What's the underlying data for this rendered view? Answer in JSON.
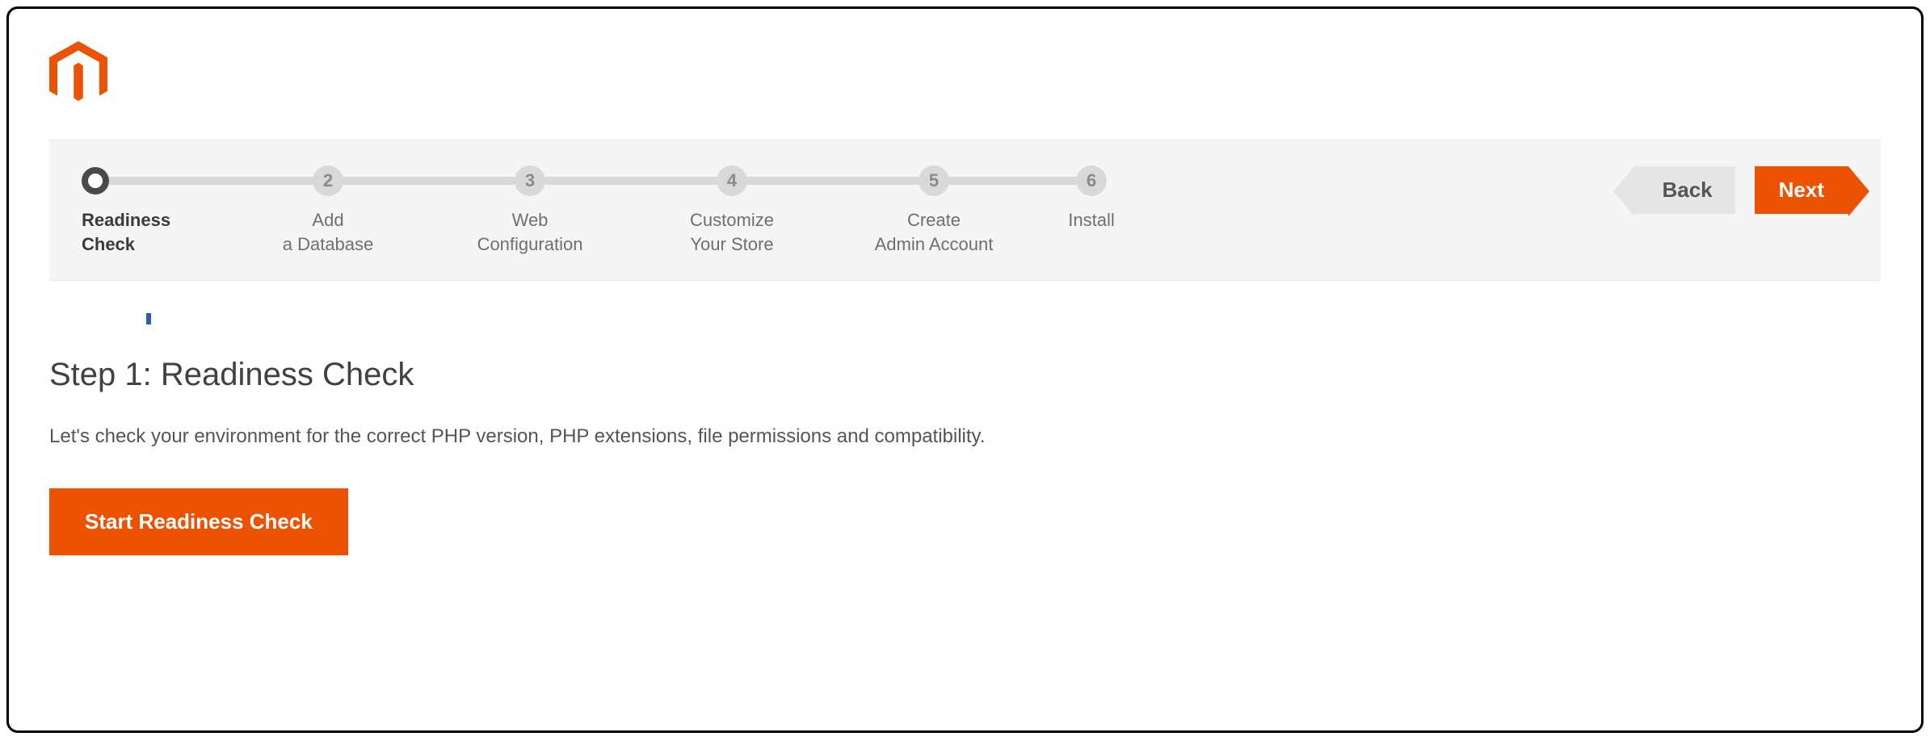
{
  "brand": {
    "name": "Magento",
    "color": "#eb5202"
  },
  "wizard": {
    "steps": [
      {
        "num": "",
        "label": "Readiness\nCheck",
        "active": true
      },
      {
        "num": "2",
        "label": "Add\na Database",
        "active": false
      },
      {
        "num": "3",
        "label": "Web\nConfiguration",
        "active": false
      },
      {
        "num": "4",
        "label": "Customize\nYour Store",
        "active": false
      },
      {
        "num": "5",
        "label": "Create\nAdmin Account",
        "active": false
      },
      {
        "num": "6",
        "label": "Install",
        "active": false
      }
    ],
    "back_label": "Back",
    "next_label": "Next"
  },
  "page": {
    "title": "Step 1: Readiness Check",
    "description": "Let's check your environment for the correct PHP version, PHP extensions, file permissions and compatibility.",
    "primary_button": "Start Readiness Check"
  }
}
